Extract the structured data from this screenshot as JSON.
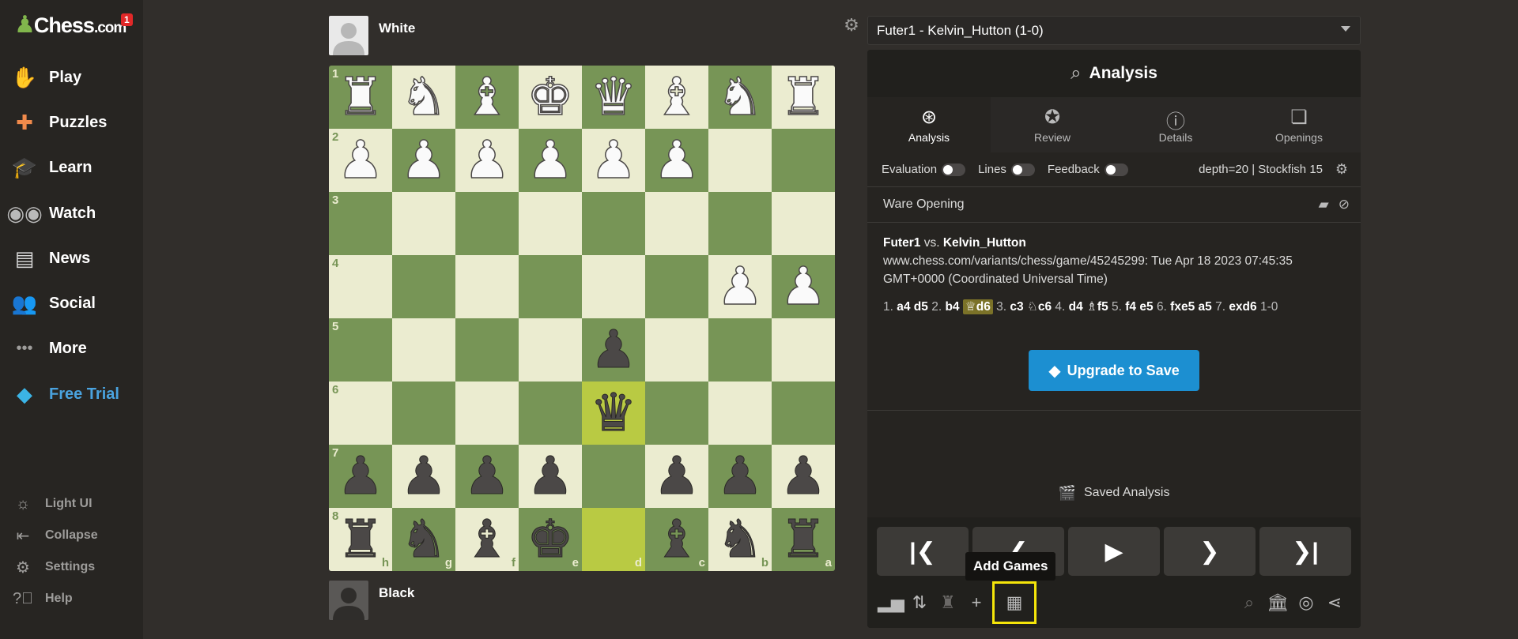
{
  "sidebar": {
    "logo_text": "Chess",
    "logo_suffix": ".com",
    "notification_count": "1",
    "nav": [
      {
        "label": "Play",
        "icon": "play-icon"
      },
      {
        "label": "Puzzles",
        "icon": "puzzles-icon"
      },
      {
        "label": "Learn",
        "icon": "learn-icon"
      },
      {
        "label": "Watch",
        "icon": "watch-icon"
      },
      {
        "label": "News",
        "icon": "news-icon"
      },
      {
        "label": "Social",
        "icon": "social-icon"
      },
      {
        "label": "More",
        "icon": "more-icon"
      },
      {
        "label": "Free Trial",
        "icon": "diamond-icon"
      }
    ],
    "bottom": [
      {
        "label": "Light UI"
      },
      {
        "label": "Collapse"
      },
      {
        "label": "Settings"
      },
      {
        "label": "Help"
      }
    ]
  },
  "players": {
    "top": "White",
    "bottom": "Black"
  },
  "board": {
    "rank_labels": [
      "1",
      "2",
      "3",
      "4",
      "5",
      "6",
      "7",
      "8"
    ],
    "file_labels": [
      "h",
      "g",
      "f",
      "e",
      "d",
      "c",
      "b",
      "a"
    ],
    "rows": [
      [
        "wR",
        "wN",
        "wB",
        "wK",
        "wQ",
        "wB",
        "wN",
        "wR"
      ],
      [
        "wP",
        "wP",
        "wP",
        "wP",
        "wP",
        "wP",
        "",
        ""
      ],
      [
        "",
        "",
        "",
        "",
        "",
        "",
        "",
        ""
      ],
      [
        "",
        "",
        "",
        "",
        "",
        "",
        "wP",
        "wP"
      ],
      [
        "",
        "",
        "",
        "",
        "bP",
        "",
        "",
        ""
      ],
      [
        "",
        "",
        "",
        "",
        "bQ",
        "",
        "",
        ""
      ],
      [
        "bP",
        "bP",
        "bP",
        "bP",
        "",
        "bP",
        "bP",
        "bP"
      ],
      [
        "bR",
        "bN",
        "bB",
        "bK",
        "",
        "bB",
        "bN",
        "bR"
      ]
    ],
    "highlighted": [
      "5,4",
      "7,4"
    ]
  },
  "right_panel": {
    "game_select": "Futer1 - Kelvin_Hutton (1-0)",
    "header_title": "Analysis",
    "tabs": [
      {
        "label": "Analysis",
        "active": true
      },
      {
        "label": "Review",
        "active": false
      },
      {
        "label": "Details",
        "active": false
      },
      {
        "label": "Openings",
        "active": false
      }
    ],
    "options": {
      "evaluation": "Evaluation",
      "lines": "Lines",
      "feedback": "Feedback",
      "engine": "depth=20 | Stockfish 15"
    },
    "opening": "Ware Opening",
    "pgn": {
      "white": "Futer1",
      "vs": "vs.",
      "black": "Kelvin_Hutton",
      "source": "www.chess.com/variants/chess/game/45245299: Tue Apr 18 2023 07:45:35 GMT+0000 (Coordinated Universal Time)"
    },
    "moves": [
      {
        "num": "1.",
        "white": "a4",
        "black": "d5"
      },
      {
        "num": "2.",
        "white": "b4",
        "black": "d6",
        "black_piece": "♕",
        "current": true
      },
      {
        "num": "3.",
        "white": "c3",
        "black": "c6",
        "black_piece": "♘"
      },
      {
        "num": "4.",
        "white": "d4",
        "black": "f5",
        "black_piece": "♗"
      },
      {
        "num": "5.",
        "white": "f4",
        "black": "e5"
      },
      {
        "num": "6.",
        "white": "fxe5",
        "black": "a5"
      },
      {
        "num": "7.",
        "white": "exd6",
        "black": ""
      }
    ],
    "result": "1-0",
    "upgrade_label": "Upgrade to Save",
    "saved_analysis": "Saved Analysis",
    "tooltip": "Add Games"
  }
}
